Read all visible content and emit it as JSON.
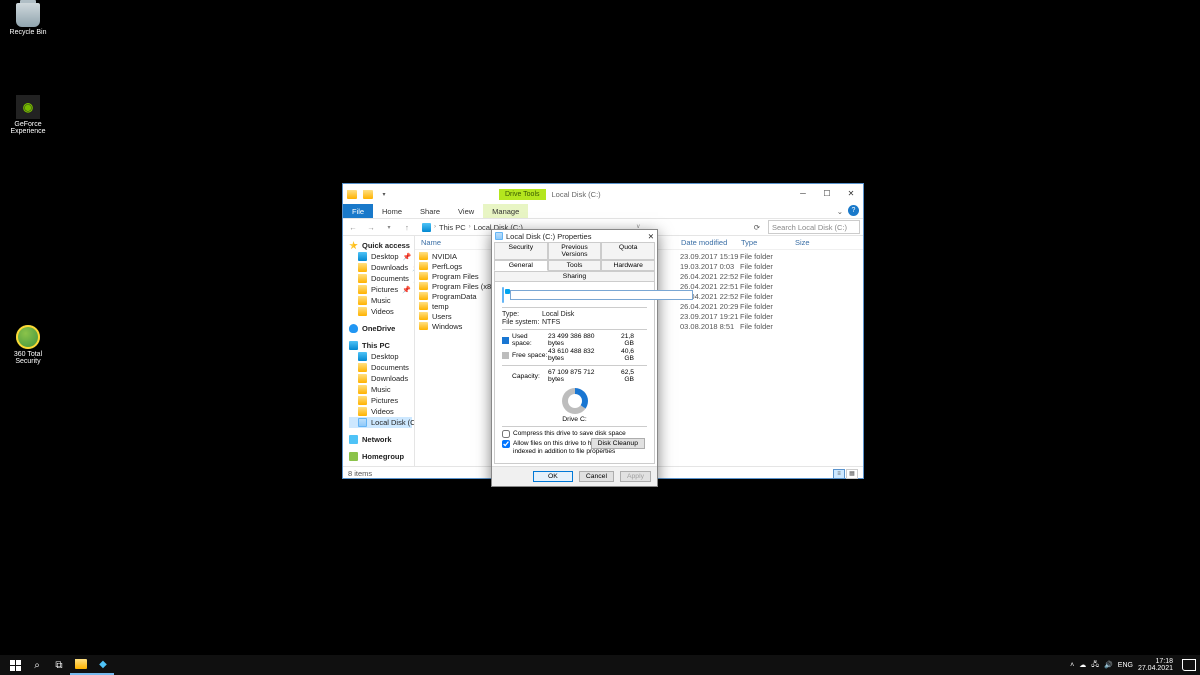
{
  "desktop": {
    "icons": [
      {
        "name": "recycle-bin",
        "label": "Recycle Bin"
      },
      {
        "name": "geforce",
        "label": "GeForce Experience"
      },
      {
        "name": "360sec",
        "label": "360 Total Security"
      }
    ]
  },
  "explorer": {
    "drive_tools": "Drive Tools",
    "title": "Local Disk (C:)",
    "ribbon": {
      "file": "File",
      "home": "Home",
      "share": "Share",
      "view": "View",
      "manage": "Manage"
    },
    "breadcrumb": {
      "root": "This PC",
      "drive": "Local Disk (C:)"
    },
    "search_placeholder": "Search Local Disk (C:)",
    "nav": {
      "quick": "Quick access",
      "desktop": "Desktop",
      "downloads": "Downloads",
      "documents": "Documents",
      "pictures": "Pictures",
      "music": "Music",
      "videos": "Videos",
      "onedrive": "OneDrive",
      "thispc": "This PC",
      "local": "Local Disk (C:)",
      "network": "Network",
      "homegroup": "Homegroup"
    },
    "cols": {
      "name": "Name",
      "date": "Date modified",
      "type": "Type",
      "size": "Size"
    },
    "rows": [
      {
        "name": "NVIDIA",
        "date": "23.09.2017 15:19",
        "type": "File folder"
      },
      {
        "name": "PerfLogs",
        "date": "19.03.2017 0:03",
        "type": "File folder"
      },
      {
        "name": "Program Files",
        "date": "26.04.2021 22:52",
        "type": "File folder"
      },
      {
        "name": "Program Files (x86)",
        "date": "26.04.2021 22:51",
        "type": "File folder"
      },
      {
        "name": "ProgramData",
        "date": "26.04.2021 22:52",
        "type": "File folder"
      },
      {
        "name": "temp",
        "date": "26.04.2021 20:29",
        "type": "File folder"
      },
      {
        "name": "Users",
        "date": "23.09.2017 19:21",
        "type": "File folder"
      },
      {
        "name": "Windows",
        "date": "03.08.2018 8:51",
        "type": "File folder"
      }
    ],
    "status": "8 items"
  },
  "props": {
    "title": "Local Disk (C:) Properties",
    "tabs": {
      "security": "Security",
      "prev": "Previous Versions",
      "quota": "Quota",
      "general": "General",
      "tools": "Tools",
      "hardware": "Hardware",
      "sharing": "Sharing"
    },
    "label_input": "",
    "type_k": "Type:",
    "type_v": "Local Disk",
    "fs_k": "File system:",
    "fs_v": "NTFS",
    "used_k": "Used space:",
    "used_b": "23 499 386 880 bytes",
    "used_g": "21,8 GB",
    "free_k": "Free space:",
    "free_b": "43 610 488 832 bytes",
    "free_g": "40,6 GB",
    "cap_k": "Capacity:",
    "cap_b": "67 109 875 712 bytes",
    "cap_g": "62,5 GB",
    "pie_label": "Drive C:",
    "cleanup": "Disk Cleanup",
    "compress": "Compress this drive to save disk space",
    "index": "Allow files on this drive to have contents indexed in addition to file properties",
    "ok": "OK",
    "cancel": "Cancel",
    "apply": "Apply"
  },
  "taskbar": {
    "lang": "ENG",
    "time": "17:18",
    "date": "27.04.2021"
  }
}
